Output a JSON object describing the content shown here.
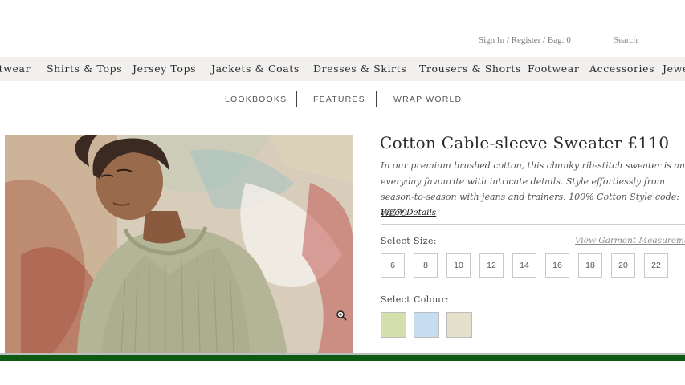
{
  "header": {
    "account_text": "Sign In / Register / Bag: 0",
    "search_placeholder": "Search"
  },
  "main_nav": [
    {
      "label": "itwear"
    },
    {
      "label": "Shirts & Tops"
    },
    {
      "label": "Jersey Tops"
    },
    {
      "label": "Jackets & Coats"
    },
    {
      "label": "Dresses & Skirts"
    },
    {
      "label": "Trousers & Shorts"
    },
    {
      "label": "Footwear"
    },
    {
      "label": "Accessories"
    },
    {
      "label": "Jewe"
    }
  ],
  "sub_nav": [
    {
      "label": "LOOKBOOKS"
    },
    {
      "label": "FEATURES"
    },
    {
      "label": "WRAP WORLD"
    }
  ],
  "product": {
    "title": "Cotton Cable-sleeve Sweater £110",
    "description": "In our premium brushed cotton, this chunky rib-stitch sweater is an everyday favourite with intricate details. Style effortlessly from season-to-season with jeans and trainers. 100% Cotton Style code: WZ79",
    "finer_details": "Finer Details",
    "select_size_label": "Select Size:",
    "measurement_link": "View Garment Measurement",
    "sizes": [
      "6",
      "8",
      "10",
      "12",
      "14",
      "16",
      "18",
      "20",
      "22"
    ],
    "select_colour_label": "Select Colour:",
    "colours": [
      {
        "name": "sage",
        "hex": "#d4dfae"
      },
      {
        "name": "light-blue",
        "hex": "#c6dcf1"
      },
      {
        "name": "stone",
        "hex": "#e4e0cc"
      }
    ]
  },
  "icons": {
    "zoom": "zoom-icon"
  },
  "colors": {
    "footer_bar": "#0d5a12",
    "nav_background": "#f1f0ef"
  }
}
